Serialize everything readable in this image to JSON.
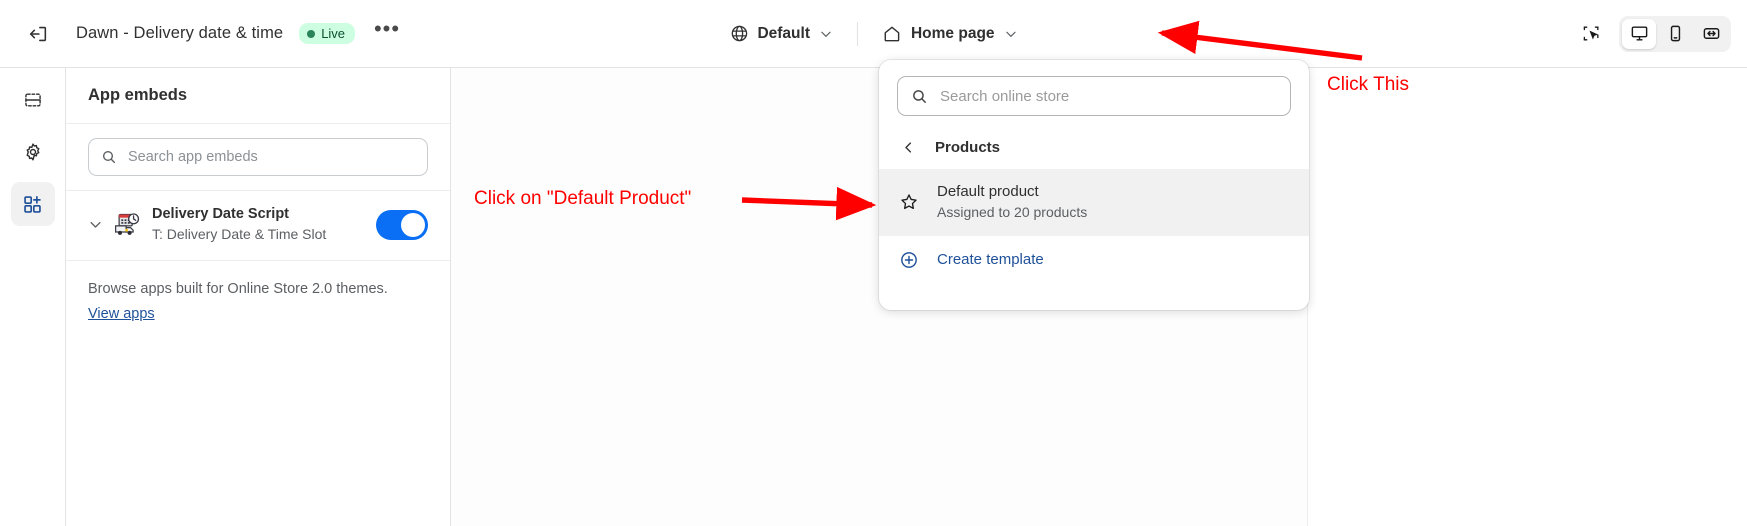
{
  "topbar": {
    "exit_icon": "exit-icon",
    "theme_title": "Dawn - Delivery date & time",
    "status_badge": "Live",
    "more_label": "•••",
    "market_selector": {
      "icon": "globe-icon",
      "label": "Default",
      "chevron": "chevron-down-icon"
    },
    "page_selector": {
      "icon": "home-icon",
      "label": "Home page",
      "chevron": "chevron-down-icon"
    },
    "view_buttons": [
      {
        "name": "select-tool-icon",
        "active": false
      },
      {
        "name": "desktop-view-icon",
        "active": true
      },
      {
        "name": "mobile-view-icon",
        "active": false
      },
      {
        "name": "fullwidth-view-icon",
        "active": false
      }
    ]
  },
  "rail": {
    "items": [
      {
        "name": "sections-icon",
        "active": false
      },
      {
        "name": "gear-icon",
        "active": false
      },
      {
        "name": "app-embeds-icon",
        "active": true
      }
    ]
  },
  "panel": {
    "title": "App embeds",
    "search": {
      "placeholder": "Search app embeds",
      "value": "",
      "icon": "search-icon"
    },
    "embed": {
      "caret_icon": "chevron-down-icon",
      "logo_icon": "delivery-truck-calendar-icon",
      "title": "Delivery Date Script",
      "subtitle": "T: Delivery Date & Time Slot",
      "toggle_on": true
    },
    "footer": {
      "text": "Browse apps built for Online Store 2.0 themes.",
      "link": "View apps"
    }
  },
  "dropdown": {
    "search": {
      "placeholder": "Search online store",
      "value": "",
      "icon": "search-icon"
    },
    "back": {
      "icon": "chevron-left-icon",
      "label": "Products"
    },
    "items": [
      {
        "icon": "star-icon",
        "title": "Default product",
        "subtitle": "Assigned to 20 products",
        "selected": true
      }
    ],
    "create": {
      "icon": "plus-circle-icon",
      "label": "Create template"
    }
  },
  "annotations": [
    {
      "text": "Click on \"Default Product\"",
      "color": "#ff0000"
    },
    {
      "text": "Click This",
      "color": "#ff0000"
    }
  ],
  "colors": {
    "accent_blue": "#0a6ff5",
    "link_blue": "#1f5199",
    "badge_green_bg": "#cdfee1",
    "badge_green_text": "#0c5132",
    "annotation_red": "#ff0000"
  }
}
